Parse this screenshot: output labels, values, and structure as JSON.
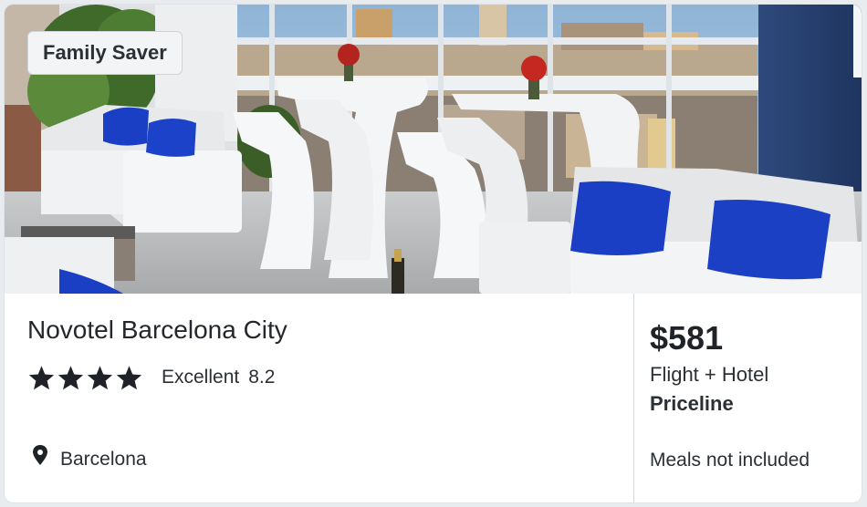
{
  "badge": {
    "label": "Family Saver"
  },
  "hotel": {
    "name": "Novotel Barcelona City",
    "stars": 4,
    "rating_text": "Excellent",
    "rating_score": "8.2",
    "location": "Barcelona"
  },
  "offer": {
    "price": "$581",
    "package": "Flight + Hotel",
    "provider": "Priceline",
    "meals": "Meals not included"
  },
  "icons": {
    "star": "star-icon",
    "location": "map-pin-icon"
  },
  "colors": {
    "text": "#1f2327",
    "badge_bg": "#f2f4f6",
    "divider": "#d3d8dc",
    "cushion_blue": "#1a3fc4"
  }
}
